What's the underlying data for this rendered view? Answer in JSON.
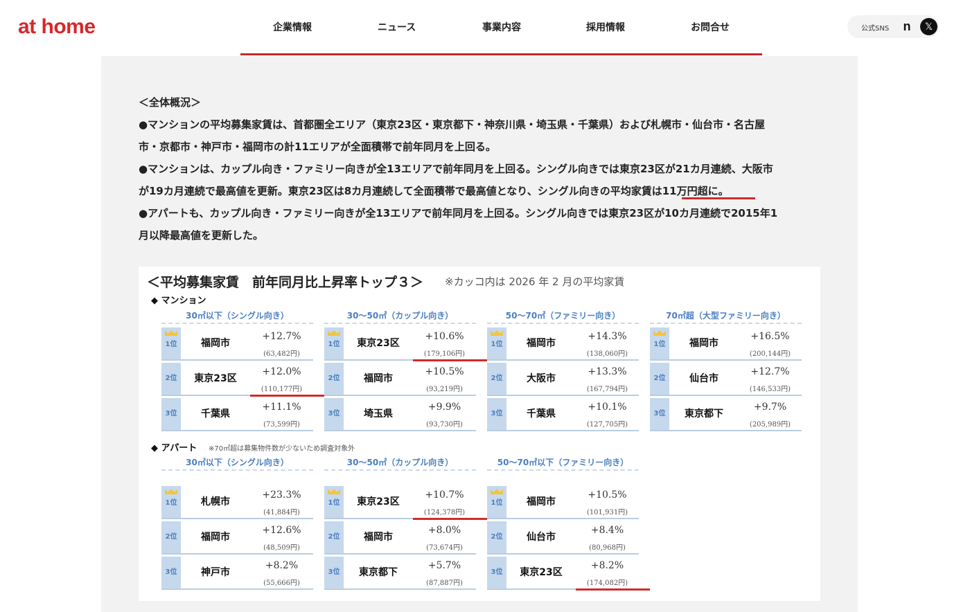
{
  "header": {
    "logo": "at home",
    "nav": [
      "企業情報",
      "ニュース",
      "事業内容",
      "採用情報",
      "お問合せ"
    ],
    "sns_label": "公式SNS",
    "sns_icons": [
      "note-icon",
      "x-icon"
    ]
  },
  "summary": {
    "heading": "＜全体概況＞",
    "lines": [
      "●マンションの平均募集家賃は、首都圏全エリア（東京23区・東京都下・神奈川県・埼玉県・千葉県）および札幌市・仙台市・名古屋",
      "市・京都市・神戸市・福岡市の計11エリアが全面積帯で前年同月を上回る。",
      "●マンションは、カップル向き・ファミリー向きが全13エリアで前年同月を上回る。シングル向きでは東京23区が21カ月連続、大阪市",
      "が19カ月連続で最高値を更新。東京23区は8カ月連続して全面積帯で最高値となり、シングル向きの平均家賃は11万円超に。",
      "●アパートも、カップル向き・ファミリー向きが全13エリアで前年同月を上回る。シングル向きでは東京23区が10カ月連続で2015年1",
      "月以降最高値を更新した。"
    ]
  },
  "figure": {
    "title": "＜平均募集家賃　前年同月比上昇率トップ３＞",
    "note": "※カッコ内は 2026 年 2 月の平均家賃",
    "rank_labels": [
      "1位",
      "2位",
      "3位"
    ],
    "mansion": {
      "label": "◆ マンション",
      "columns": [
        {
          "head": "30㎡以下（シングル向き）",
          "rows": [
            {
              "city": "福岡市",
              "pct": "+12.7%",
              "rent": "(63,482円)"
            },
            {
              "city": "東京23区",
              "pct": "+12.0%",
              "rent": "(110,177円)"
            },
            {
              "city": "千葉県",
              "pct": "+11.1%",
              "rent": "(73,599円)"
            }
          ]
        },
        {
          "head": "30～50㎡（カップル向き）",
          "rows": [
            {
              "city": "東京23区",
              "pct": "+10.6%",
              "rent": "(179,106円)"
            },
            {
              "city": "福岡市",
              "pct": "+10.5%",
              "rent": "(93,219円)"
            },
            {
              "city": "埼玉県",
              "pct": "+9.9%",
              "rent": "(93,730円)"
            }
          ]
        },
        {
          "head": "50～70㎡（ファミリー向き）",
          "rows": [
            {
              "city": "福岡市",
              "pct": "+14.3%",
              "rent": "(138,060円)"
            },
            {
              "city": "大阪市",
              "pct": "+13.3%",
              "rent": "(167,794円)"
            },
            {
              "city": "千葉県",
              "pct": "+10.1%",
              "rent": "(127,705円)"
            }
          ]
        },
        {
          "head": "70㎡超（大型ファミリー向き）",
          "rows": [
            {
              "city": "福岡市",
              "pct": "+16.5%",
              "rent": "(200,144円)"
            },
            {
              "city": "仙台市",
              "pct": "+12.7%",
              "rent": "(146,533円)"
            },
            {
              "city": "東京都下",
              "pct": "+9.7%",
              "rent": "(205,989円)"
            }
          ]
        }
      ]
    },
    "apart": {
      "label": "◆ アパート",
      "note": "※70㎡超は募集物件数が少ないため調査対象外",
      "columns": [
        {
          "head": "30㎡以下（シングル向き）",
          "rows": [
            {
              "city": "札幌市",
              "pct": "+23.3%",
              "rent": "(41,884円)"
            },
            {
              "city": "福岡市",
              "pct": "+12.6%",
              "rent": "(48,509円)"
            },
            {
              "city": "神戸市",
              "pct": "+8.2%",
              "rent": "(55,666円)"
            }
          ]
        },
        {
          "head": "30～50㎡（カップル向き）",
          "rows": [
            {
              "city": "東京23区",
              "pct": "+10.7%",
              "rent": "(124,378円)"
            },
            {
              "city": "福岡市",
              "pct": "+8.0%",
              "rent": "(73,674円)"
            },
            {
              "city": "東京都下",
              "pct": "+5.7%",
              "rent": "(87,887円)"
            }
          ]
        },
        {
          "head": "50～70㎡以下（ファミリー向き）",
          "rows": [
            {
              "city": "福岡市",
              "pct": "+10.5%",
              "rent": "(101,931円)"
            },
            {
              "city": "仙台市",
              "pct": "+8.4%",
              "rent": "(80,968円)"
            },
            {
              "city": "東京23区",
              "pct": "+8.2%",
              "rent": "(174,082円)"
            }
          ]
        }
      ]
    },
    "accent_color": "#d32a2a",
    "header_color": "#4a7fc0"
  }
}
